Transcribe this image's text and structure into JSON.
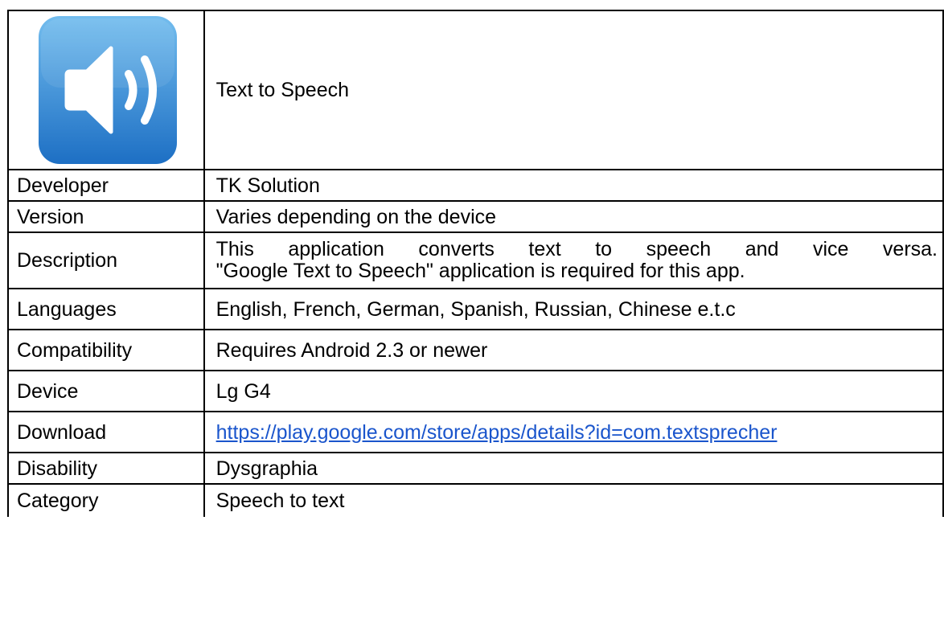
{
  "app": {
    "title": "Text to Speech",
    "icon": "speaker-volume-icon",
    "icon_colors": {
      "top": "#6fb8ec",
      "bottom": "#1f74c9",
      "glyph": "#ffffff"
    }
  },
  "rows": [
    {
      "label": "Developer",
      "value": "TK Solution"
    },
    {
      "label": "Version",
      "value": "Varies depending on the device"
    },
    {
      "label": "Description",
      "value_line1": "This application converts text to speech and vice versa.",
      "value_line2": "\"Google Text to Speech\" application is required  for this app."
    },
    {
      "label": "Languages",
      "value": "English, French, German, Spanish, Russian, Chinese e.t.c"
    },
    {
      "label": "Compatibility",
      "value": "Requires Android 2.3 or newer"
    },
    {
      "label": "Device",
      "value": "Lg G4"
    },
    {
      "label": "Download",
      "value": "https://play.google.com/store/apps/details?id=com.textsprecher",
      "link_color": "#1a55cc"
    },
    {
      "label": "Disability",
      "value": "Dysgraphia"
    },
    {
      "label": "Category",
      "value": "Speech to text"
    }
  ]
}
